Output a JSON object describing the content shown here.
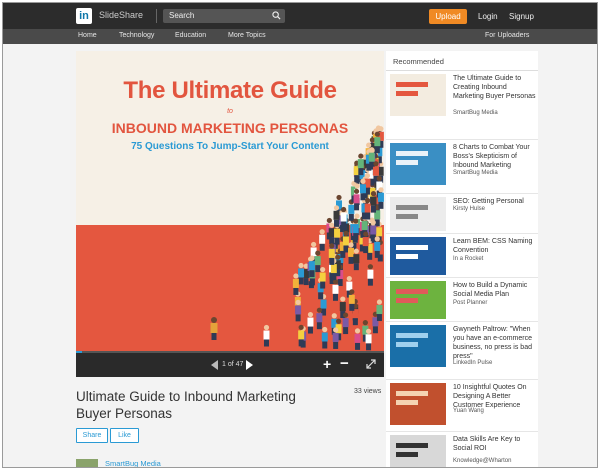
{
  "header": {
    "brand_text": "SlideShare",
    "search_placeholder": "Search",
    "upload_label": "Upload",
    "login_label": "Login",
    "signup_label": "Signup",
    "logo_letters": "in"
  },
  "nav": {
    "home": "Home",
    "technology": "Technology",
    "education": "Education",
    "more_topics": "More Topics",
    "for_uploaders": "For Uploaders"
  },
  "slide": {
    "title_line1": "The Ultimate Guide",
    "title_to": "to",
    "title_line2": "INBOUND MARKETING PERSONAS",
    "subtitle": "75 Questions To Jump-Start Your Content",
    "page_indicator": "1 of 47",
    "progress_fraction": 0.021
  },
  "document": {
    "title": "Ultimate Guide to Inbound Marketing Buyer Personas",
    "views": "33 views",
    "share_label": "Share",
    "like_label": "Like",
    "author": "SmartBug Media"
  },
  "sidebar": {
    "header": "Recommended",
    "items": [
      {
        "title": "The Ultimate Guide to Creating Inbound Marketing Buyer Personas",
        "author": "SmartBug Media",
        "thumb_color": "#f3ece0",
        "accent": "#e4573f"
      },
      {
        "title": "8 Charts to Combat Your Boss's Skepticism of Inbound Marketing",
        "author": "SmartBug Media",
        "thumb_color": "#3a8fc4",
        "accent": "#e9f2f8"
      },
      {
        "title": "SEO: Getting Personal",
        "author": "Kirsty Hulse",
        "thumb_color": "#ececec",
        "accent": "#888888"
      },
      {
        "title": "Learn BEM: CSS Naming Convention",
        "author": "In a Rocket",
        "thumb_color": "#1f5a9e",
        "accent": "#ffffff"
      },
      {
        "title": "How to Build a Dynamic Social Media Plan",
        "author": "Post Planner",
        "thumb_color": "#6db33f",
        "accent": "#e05a5a"
      },
      {
        "title": "Gwyneth Paltrow: \"When you have an e-commerce business, no press is bad press\"",
        "author": "LinkedIn Pulse",
        "thumb_color": "#1a6fa8",
        "accent": "#9fd0ee"
      },
      {
        "title": "10 Insightful Quotes On Designing A Better Customer Experience",
        "author": "Yuan Wang",
        "thumb_color": "#c1502e",
        "accent": "#f4d3b2"
      },
      {
        "title": "Data Skills Are Key to Social ROI",
        "author": "Knowledge@Wharton",
        "thumb_color": "#d8d8d8",
        "accent": "#333333"
      }
    ]
  },
  "colors": {
    "topbar": "#2c2c2c",
    "accent_orange": "#f08a24",
    "link_blue": "#2a9ad4",
    "slide_red": "#e2553f"
  }
}
